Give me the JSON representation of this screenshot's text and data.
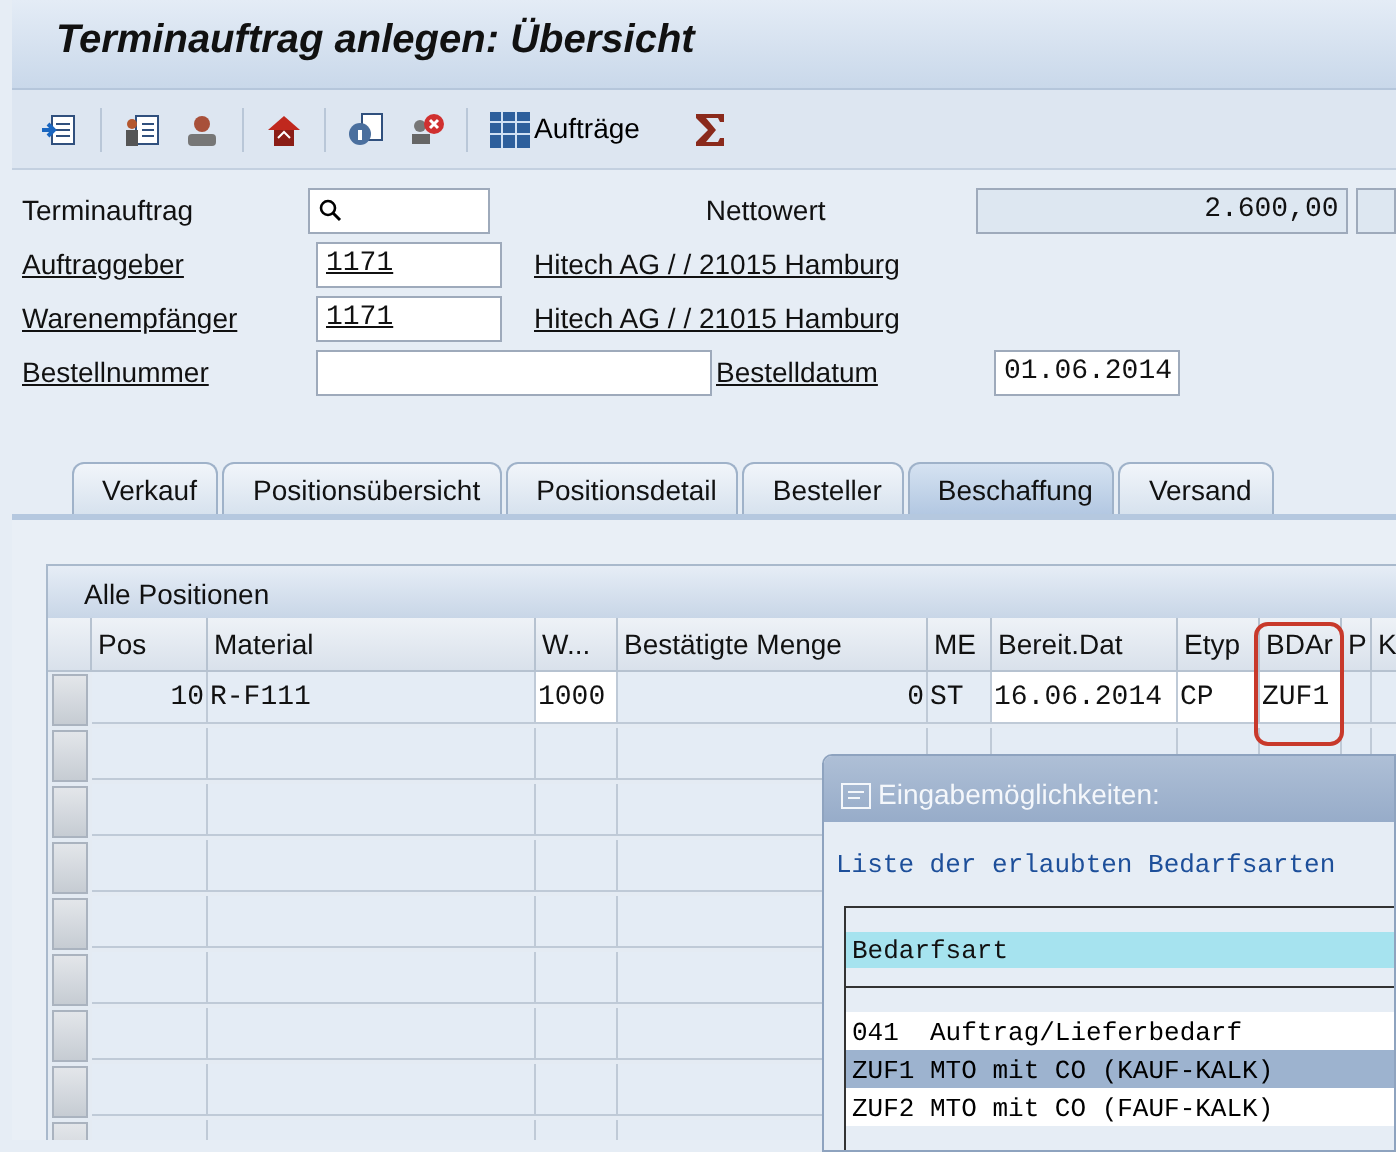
{
  "window": {
    "title": "Terminauftrag anlegen: Übersicht"
  },
  "toolbar": {
    "orders_label": "Aufträge"
  },
  "header_fields": [
    {
      "label": "Terminauftrag",
      "underlined": false,
      "kind": "search"
    },
    {
      "label": "Auftraggeber",
      "underlined": true,
      "kind": "code",
      "value": "1171",
      "description": "Hitech AG / / 21015 Hamburg"
    },
    {
      "label": "Warenempfänger",
      "underlined": true,
      "kind": "code",
      "value": "1171",
      "description": "Hitech AG / / 21015 Hamburg"
    },
    {
      "label": "Bestellnummer",
      "underlined": true,
      "kind": "wide"
    }
  ],
  "side_fields": [
    {
      "label": "Nettowert",
      "underlined": false,
      "value": "2.600,00",
      "readonly": true
    },
    {
      "label": "Bestelldatum",
      "underlined": true,
      "value": "01.06.2014",
      "readonly": false
    }
  ],
  "tabs": [
    {
      "label": "Verkauf",
      "selected": false
    },
    {
      "label": "Positionsübersicht",
      "selected": false
    },
    {
      "label": "Positionsdetail",
      "selected": false
    },
    {
      "label": "Besteller",
      "selected": false
    },
    {
      "label": "Beschaffung",
      "selected": true
    },
    {
      "label": "Versand",
      "selected": false
    }
  ],
  "table": {
    "title": "Alle Positionen",
    "columns": [
      {
        "label": "Pos",
        "kind": "number",
        "editable": false
      },
      {
        "label": "Material",
        "kind": "text",
        "editable": false
      },
      {
        "label": "W...",
        "kind": "text",
        "editable": true
      },
      {
        "label": "Bestätigte Menge",
        "kind": "number",
        "editable": false
      },
      {
        "label": "ME",
        "kind": "text",
        "editable": false
      },
      {
        "label": "Bereit.Dat",
        "kind": "text",
        "editable": true
      },
      {
        "label": "Etyp",
        "kind": "text",
        "editable": true
      },
      {
        "label": "BDAr",
        "kind": "text",
        "editable": true,
        "highlighted": true
      },
      {
        "label": "P",
        "kind": "text",
        "editable": false
      },
      {
        "label": "K",
        "kind": "text",
        "editable": false
      }
    ],
    "rows": [
      [
        "10",
        "R-F111",
        "1000",
        "0",
        "ST",
        "16.06.2014",
        "CP",
        "ZUF1",
        "",
        ""
      ]
    ]
  },
  "popup": {
    "title": "Eingabemöglichkeiten:",
    "intro": "Liste der erlaubten Bedarfsarten",
    "list_header": "Bedarfsart",
    "items": [
      {
        "code": "041",
        "text": "Auftrag/Lieferbedarf",
        "selected": false
      },
      {
        "code": "ZUF1",
        "text": "MTO mit CO (KAUF-KALK)",
        "selected": true
      },
      {
        "code": "ZUF2",
        "text": "MTO mit CO (FAUF-KALK)",
        "selected": false
      }
    ]
  }
}
